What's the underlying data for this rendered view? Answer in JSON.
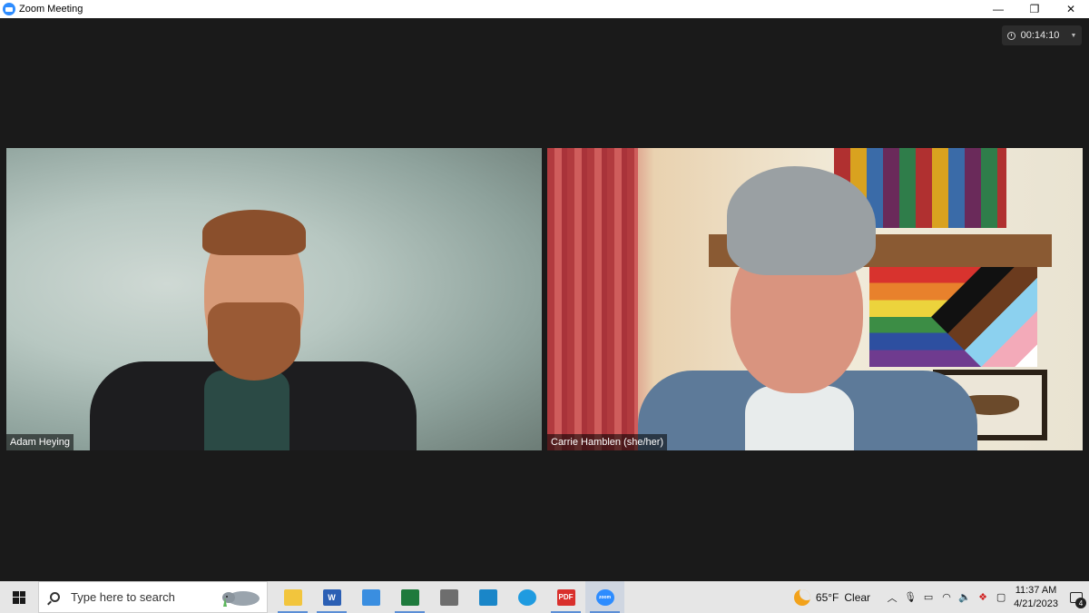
{
  "window": {
    "title": "Zoom Meeting",
    "controls": {
      "minimize": "—",
      "restore": "❐",
      "close": "✕"
    }
  },
  "meeting": {
    "timer": "00:14:10",
    "participants": [
      {
        "name": "Adam Heying"
      },
      {
        "name": "Carrie Hamblen (she/her)"
      }
    ]
  },
  "taskbar": {
    "search_placeholder": "Type here to search",
    "apps": [
      {
        "name": "file-explorer",
        "label": "",
        "color": "#f2c53d"
      },
      {
        "name": "word",
        "label": "W",
        "color": "#2b5fb4"
      },
      {
        "name": "app-3",
        "label": "",
        "color": "#3a8ee0"
      },
      {
        "name": "excel",
        "label": "",
        "color": "#1e7a3c"
      },
      {
        "name": "app-5",
        "label": "",
        "color": "#6e6e6e"
      },
      {
        "name": "app-6",
        "label": "",
        "color": "#1a86c8"
      },
      {
        "name": "edge",
        "label": "",
        "color": "#1f9be0"
      },
      {
        "name": "pdf",
        "label": "PDF",
        "color": "#d9302c"
      },
      {
        "name": "zoom",
        "label": "zoom",
        "color": "#2d8cff",
        "active": true
      }
    ],
    "weather": {
      "temp": "65°F",
      "condition": "Clear"
    },
    "clock": {
      "time": "11:37 AM",
      "date": "4/21/2023"
    },
    "notification_count": "4"
  }
}
